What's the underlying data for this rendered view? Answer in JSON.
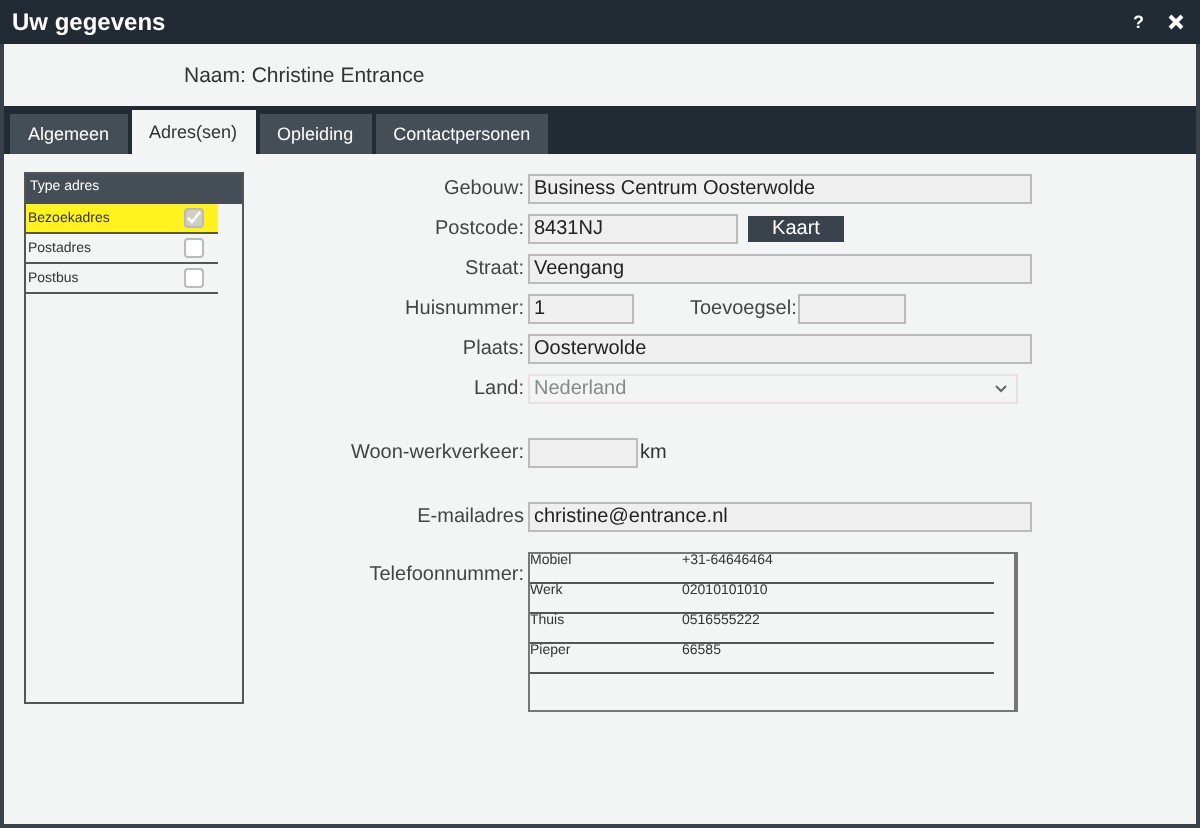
{
  "window": {
    "title": "Uw gegevens",
    "help": "?"
  },
  "name_line": "Naam: Christine Entrance",
  "tabs": [
    {
      "label": "Algemeen",
      "selected": false
    },
    {
      "label": "Adres(sen)",
      "selected": true
    },
    {
      "label": "Opleiding",
      "selected": false
    },
    {
      "label": "Contactpersonen",
      "selected": false
    }
  ],
  "address_types": {
    "header": "Type adres",
    "items": [
      {
        "label": "Bezoekadres",
        "checked": true,
        "selected": true
      },
      {
        "label": "Postadres",
        "checked": false,
        "selected": false
      },
      {
        "label": "Postbus",
        "checked": false,
        "selected": false
      }
    ]
  },
  "form": {
    "building": {
      "label": "Gebouw:",
      "value": "Business Centrum Oosterwolde"
    },
    "postcode": {
      "label": "Postcode:",
      "value": "8431NJ"
    },
    "map_button": "Kaart",
    "street": {
      "label": "Straat:",
      "value": "Veengang"
    },
    "house_number": {
      "label": "Huisnummer:",
      "value": "1"
    },
    "addition": {
      "label": "Toevoegsel:"
    },
    "city": {
      "label": "Plaats:",
      "value": "Oosterwolde"
    },
    "country": {
      "label": "Land:",
      "value": "Nederland"
    },
    "commute": {
      "label": "Woon-werkverkeer:",
      "unit": "km"
    },
    "email": {
      "label": "E-mailadres",
      "value": "christine@entrance.nl"
    },
    "phones": {
      "label": "Telefoonnummer:",
      "rows": [
        {
          "type": "Mobiel",
          "number": "+31-64646464"
        },
        {
          "type": "Werk",
          "number": "02010101010"
        },
        {
          "type": "Thuis",
          "number": "0516555222"
        },
        {
          "type": "Pieper",
          "number": "66585"
        }
      ]
    }
  }
}
